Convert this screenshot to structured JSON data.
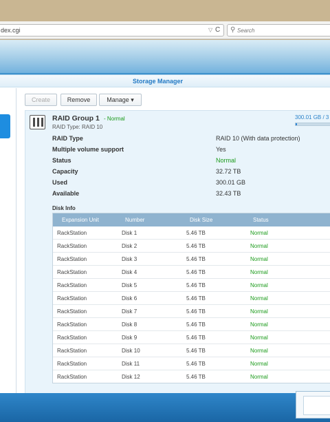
{
  "browser": {
    "url": "dex.cgi",
    "search_placeholder": "Search",
    "dropdown_glyph": "▽",
    "reload_glyph": "C",
    "search_glyph": "⚲"
  },
  "window": {
    "title": "Storage Manager"
  },
  "toolbar": {
    "create": "Create",
    "remove": "Remove",
    "manage": "Manage ▾"
  },
  "raid": {
    "title": "RAID Group 1",
    "status_inline": "- Normal",
    "subtitle": "RAID Type: RAID 10",
    "usage_text": "300.01 GB / 3",
    "usage_fraction": 0.009,
    "properties": [
      {
        "label": "RAID Type",
        "value": "RAID 10 (With data protection)",
        "ok": false
      },
      {
        "label": "Multiple volume support",
        "value": "Yes",
        "ok": false
      },
      {
        "label": "Status",
        "value": "Normal",
        "ok": true
      },
      {
        "label": "Capacity",
        "value": "32.72 TB",
        "ok": false
      },
      {
        "label": "Used",
        "value": "300.01 GB",
        "ok": false
      },
      {
        "label": "Available",
        "value": "32.43 TB",
        "ok": false
      }
    ]
  },
  "disk_info": {
    "label": "Disk Info",
    "columns": [
      "Expansion Unit",
      "Number",
      "Disk Size",
      "Status"
    ],
    "rows": [
      [
        "RackStation",
        "Disk 1",
        "5.46 TB",
        "Normal"
      ],
      [
        "RackStation",
        "Disk 2",
        "5.46 TB",
        "Normal"
      ],
      [
        "RackStation",
        "Disk 3",
        "5.46 TB",
        "Normal"
      ],
      [
        "RackStation",
        "Disk 4",
        "5.46 TB",
        "Normal"
      ],
      [
        "RackStation",
        "Disk 5",
        "5.46 TB",
        "Normal"
      ],
      [
        "RackStation",
        "Disk 6",
        "5.46 TB",
        "Normal"
      ],
      [
        "RackStation",
        "Disk 7",
        "5.46 TB",
        "Normal"
      ],
      [
        "RackStation",
        "Disk 8",
        "5.46 TB",
        "Normal"
      ],
      [
        "RackStation",
        "Disk 9",
        "5.46 TB",
        "Normal"
      ],
      [
        "RackStation",
        "Disk 10",
        "5.46 TB",
        "Normal"
      ],
      [
        "RackStation",
        "Disk 11",
        "5.46 TB",
        "Normal"
      ],
      [
        "RackStation",
        "Disk 12",
        "5.46 TB",
        "Normal"
      ]
    ]
  },
  "colors": {
    "accent": "#2279c4",
    "ok": "#1a9a1a",
    "table_header": "#8fb3cf"
  }
}
